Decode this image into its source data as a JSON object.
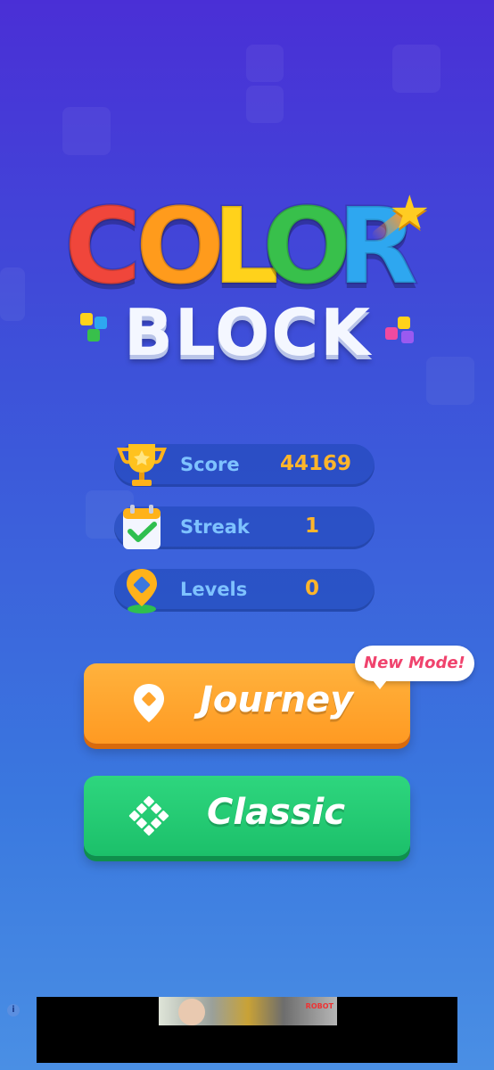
{
  "logo": {
    "word1_letters": [
      {
        "ch": "C",
        "color": "#f0463b"
      },
      {
        "ch": "O",
        "color": "#ff9b1c"
      },
      {
        "ch": "L",
        "color": "#ffd21b"
      },
      {
        "ch": "O",
        "color": "#38c04b"
      },
      {
        "ch": "R",
        "color": "#2ea7f0"
      }
    ],
    "word2": "BLOCK"
  },
  "stats": [
    {
      "label": "Score",
      "value": "44169",
      "icon": "trophy-icon"
    },
    {
      "label": "Streak",
      "value": "1",
      "icon": "calendar-check-icon"
    },
    {
      "label": "Levels",
      "value": "0",
      "icon": "map-pin-icon"
    }
  ],
  "buttons": {
    "journey": {
      "label": "Journey",
      "badge": "New Mode!",
      "icon": "location-pin-icon"
    },
    "classic": {
      "label": "Classic",
      "icon": "grid-diamond-icon"
    }
  },
  "ad": {
    "brand": "ROBOT"
  },
  "colors": {
    "journey": "#ffa52e",
    "classic": "#22c872",
    "stat_label": "#7ec2ff",
    "stat_value": "#ffb52b",
    "badge_text": "#f0436d"
  }
}
